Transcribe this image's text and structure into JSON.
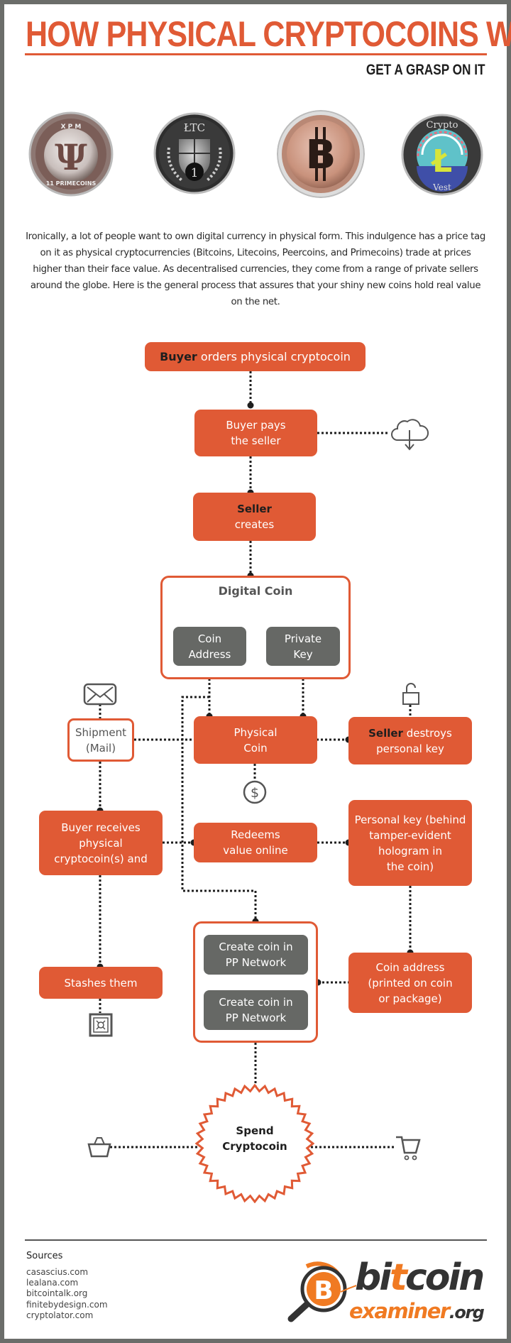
{
  "header": {
    "title": "HOW PHYSICAL CRYPTOCOINS WORK",
    "subtitle": "GET A GRASP ON IT"
  },
  "coins": [
    {
      "name": "Primecoin",
      "face_top": "X P M",
      "face_bottom": "11 PRIMECOINS",
      "symbol": "Ψ"
    },
    {
      "name": "Litecoin",
      "face_top": "ŁTC",
      "symbol": "1"
    },
    {
      "name": "Bitcoin",
      "symbol": "B"
    },
    {
      "name": "CryptoVest",
      "face_top": "Crypto",
      "face_bottom": "Vest",
      "symbol": "Ł"
    }
  ],
  "intro": "Ironically, a lot of people want  to own digital currency in physical form. This indulgence has a price tag on it as physical cryptocurrencies (Bitcoins, Litecoins, Peercoins, and Primecoins) trade at prices higher than their face value. As decentralised currencies, they come from a range of private sellers around the globe. Here is the general process that assures that your shiny new coins hold real value on the net.",
  "flow": {
    "buyer_orders": {
      "bold": "Buyer",
      "rest": " orders physical cryptocoin"
    },
    "buyer_pays": {
      "line1": "Buyer pays",
      "line2": "the seller"
    },
    "seller_creates": {
      "bold": "Seller",
      "rest": "creates"
    },
    "digital_coin": {
      "title": "Digital Coin"
    },
    "coin_address": {
      "line1": "Coin",
      "line2": "Address"
    },
    "private_key": {
      "line1": "Private",
      "line2": "Key"
    },
    "shipment": {
      "line1": "Shipment",
      "line2": "(Mail)"
    },
    "physical_coin": {
      "line1": "Physical",
      "line2": "Coin"
    },
    "seller_destroys": {
      "bold": "Seller",
      "rest": " destroys",
      "line2": "personal key"
    },
    "buyer_receives": {
      "line1": "Buyer receives",
      "line2": "physical",
      "line3": "cryptocoin(s) and"
    },
    "redeems": {
      "line1": "Redeems",
      "line2": "value online"
    },
    "personal_key": {
      "line1": "Personal key (behind",
      "line2": "tamper-evident",
      "line3": "hologram in",
      "line4": "the coin)"
    },
    "stashes": {
      "label": "Stashes them"
    },
    "pp_create_1": {
      "line1": "Create coin in",
      "line2": "PP Network"
    },
    "pp_create_2": {
      "line1": "Create coin in",
      "line2": "PP Network"
    },
    "coin_address_printed": {
      "line1": "Coin address",
      "line2": "(printed on coin",
      "line3": "or package)"
    },
    "spend": {
      "line1": "Spend",
      "line2": "Cryptocoin"
    }
  },
  "icons": {
    "cloud": "cloud-download-icon",
    "mail": "envelope-icon",
    "lock": "unlocked-padlock-icon",
    "dollar": "dollar-coin-icon",
    "safe": "safe-icon",
    "basket": "shopping-basket-icon",
    "cart": "shopping-cart-icon"
  },
  "colors": {
    "accent": "#e05a35",
    "grey_box": "#666865",
    "frame": "#6b6d6a",
    "logo_orange": "#f07a22"
  },
  "footer": {
    "sources_title": "Sources",
    "sources": [
      "casascius.com",
      "lealana.com",
      "bitcointalk.org",
      "finitebydesign.com",
      "cryptolator.com"
    ],
    "logo": {
      "word1_a": "bi",
      "word1_t": "t",
      "word1_b": "coin",
      "word2": "examiner",
      "word2_tld": ".org"
    }
  }
}
